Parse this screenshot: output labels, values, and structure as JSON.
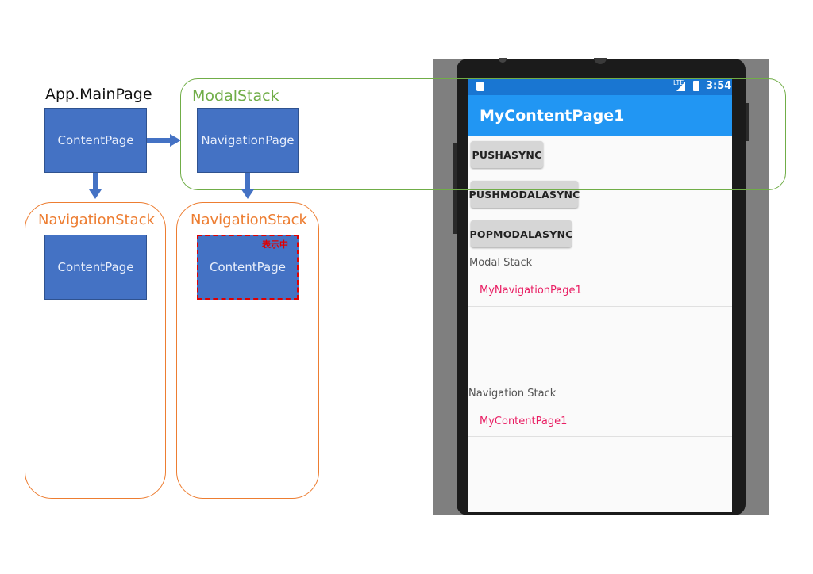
{
  "left": {
    "app_main_page_title": "App.MainPage",
    "modal_stack_title": "ModalStack",
    "nav_stack_left_title": "NavigationStack",
    "nav_stack_right_title": "NavigationStack",
    "content_page_main": "ContentPage",
    "navigation_page": "NavigationPage",
    "content_page_left_stack": "ContentPage",
    "content_page_right_stack": "ContentPage",
    "displaying_badge": "表示中"
  },
  "phone": {
    "status_time": "3:54",
    "status_network": "LTE",
    "app_title": "MyContentPage1",
    "buttons": {
      "push_async": "PUSHASYNC",
      "push_modal_async": "PUSHMODALASYNC",
      "pop_modal_async": "POPMODALASYNC"
    },
    "modal_stack_label": "Modal Stack",
    "modal_stack_items": [
      "MyNavigationPage1"
    ],
    "navigation_stack_label": "Navigation Stack",
    "navigation_stack_items": [
      "MyContentPage1"
    ]
  },
  "colors": {
    "diagram_blue": "#4472c4",
    "stack_orange": "#ed7d31",
    "modal_green": "#70ad47",
    "app_bar_blue": "#2196f3",
    "list_item_pink": "#e91e63",
    "badge_red": "#e00000"
  }
}
